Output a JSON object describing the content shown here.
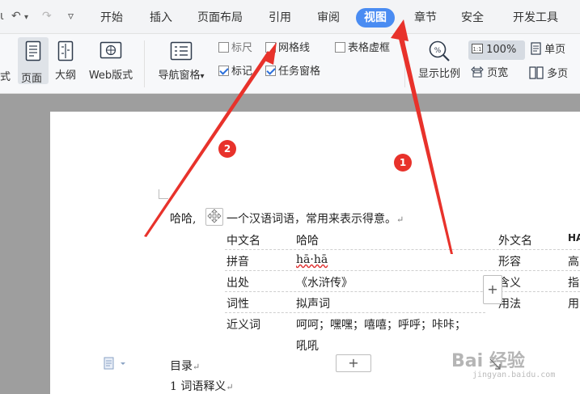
{
  "quick_access": {
    "undo": "↶",
    "undo_menu": "▾",
    "redo": "↷",
    "more": "▿"
  },
  "tabs": [
    {
      "label": "开始"
    },
    {
      "label": "插入"
    },
    {
      "label": "页面布局"
    },
    {
      "label": "引用"
    },
    {
      "label": "审阅"
    },
    {
      "label": "视图",
      "active": true
    },
    {
      "label": "章节"
    },
    {
      "label": "安全"
    },
    {
      "label": "开发工具"
    }
  ],
  "ribbon": {
    "view_modes": {
      "read_partial": "式",
      "page": "页面",
      "outline": "大纲",
      "web": "Web版式"
    },
    "nav_pane": "导航窗格",
    "nav_pane_arrow": "▾",
    "checkboxes": {
      "ruler": "标尺",
      "gridlines": "网格线",
      "table_gridlines": "表格虚框",
      "markers": "标记",
      "task_pane": "任务窗格"
    },
    "zoom": {
      "display_ratio": "显示比例",
      "percent_value": "100%",
      "page_width": "页宽",
      "single_page": "单页",
      "multi_page": "多页"
    }
  },
  "document": {
    "intro_head": "哈哈,",
    "intro_tail": "一个汉语词语，常用来表示得意。",
    "return_mark": "↵",
    "para_mark": "↵",
    "left_table": [
      {
        "label": "中文名",
        "value": "哈哈"
      },
      {
        "label": "拼音",
        "value": "hā·hā"
      },
      {
        "label": "出处",
        "value": "《水浒传》"
      },
      {
        "label": "词性",
        "value": "拟声词"
      },
      {
        "label": "近义词",
        "value": "呵呵；嘿嘿；嘻嘻；呼呼；咔咔；",
        "value2": "吼吼"
      }
    ],
    "right_table": [
      {
        "label": "外文名",
        "value": "HA"
      },
      {
        "label": "形容",
        "value": "高"
      },
      {
        "label": "含义",
        "value": "指"
      },
      {
        "label": "用法",
        "value": "用"
      }
    ],
    "toc_title": "目录",
    "toc_item1": "1 词语释义",
    "plus": "+"
  },
  "annotations": {
    "step1": "1",
    "step2": "2"
  },
  "watermark": {
    "main": "Bai 经验",
    "sub": "jingyan.baidu.com"
  },
  "colors": {
    "accent": "#4a8cf2",
    "arrow": "#e8322b"
  }
}
